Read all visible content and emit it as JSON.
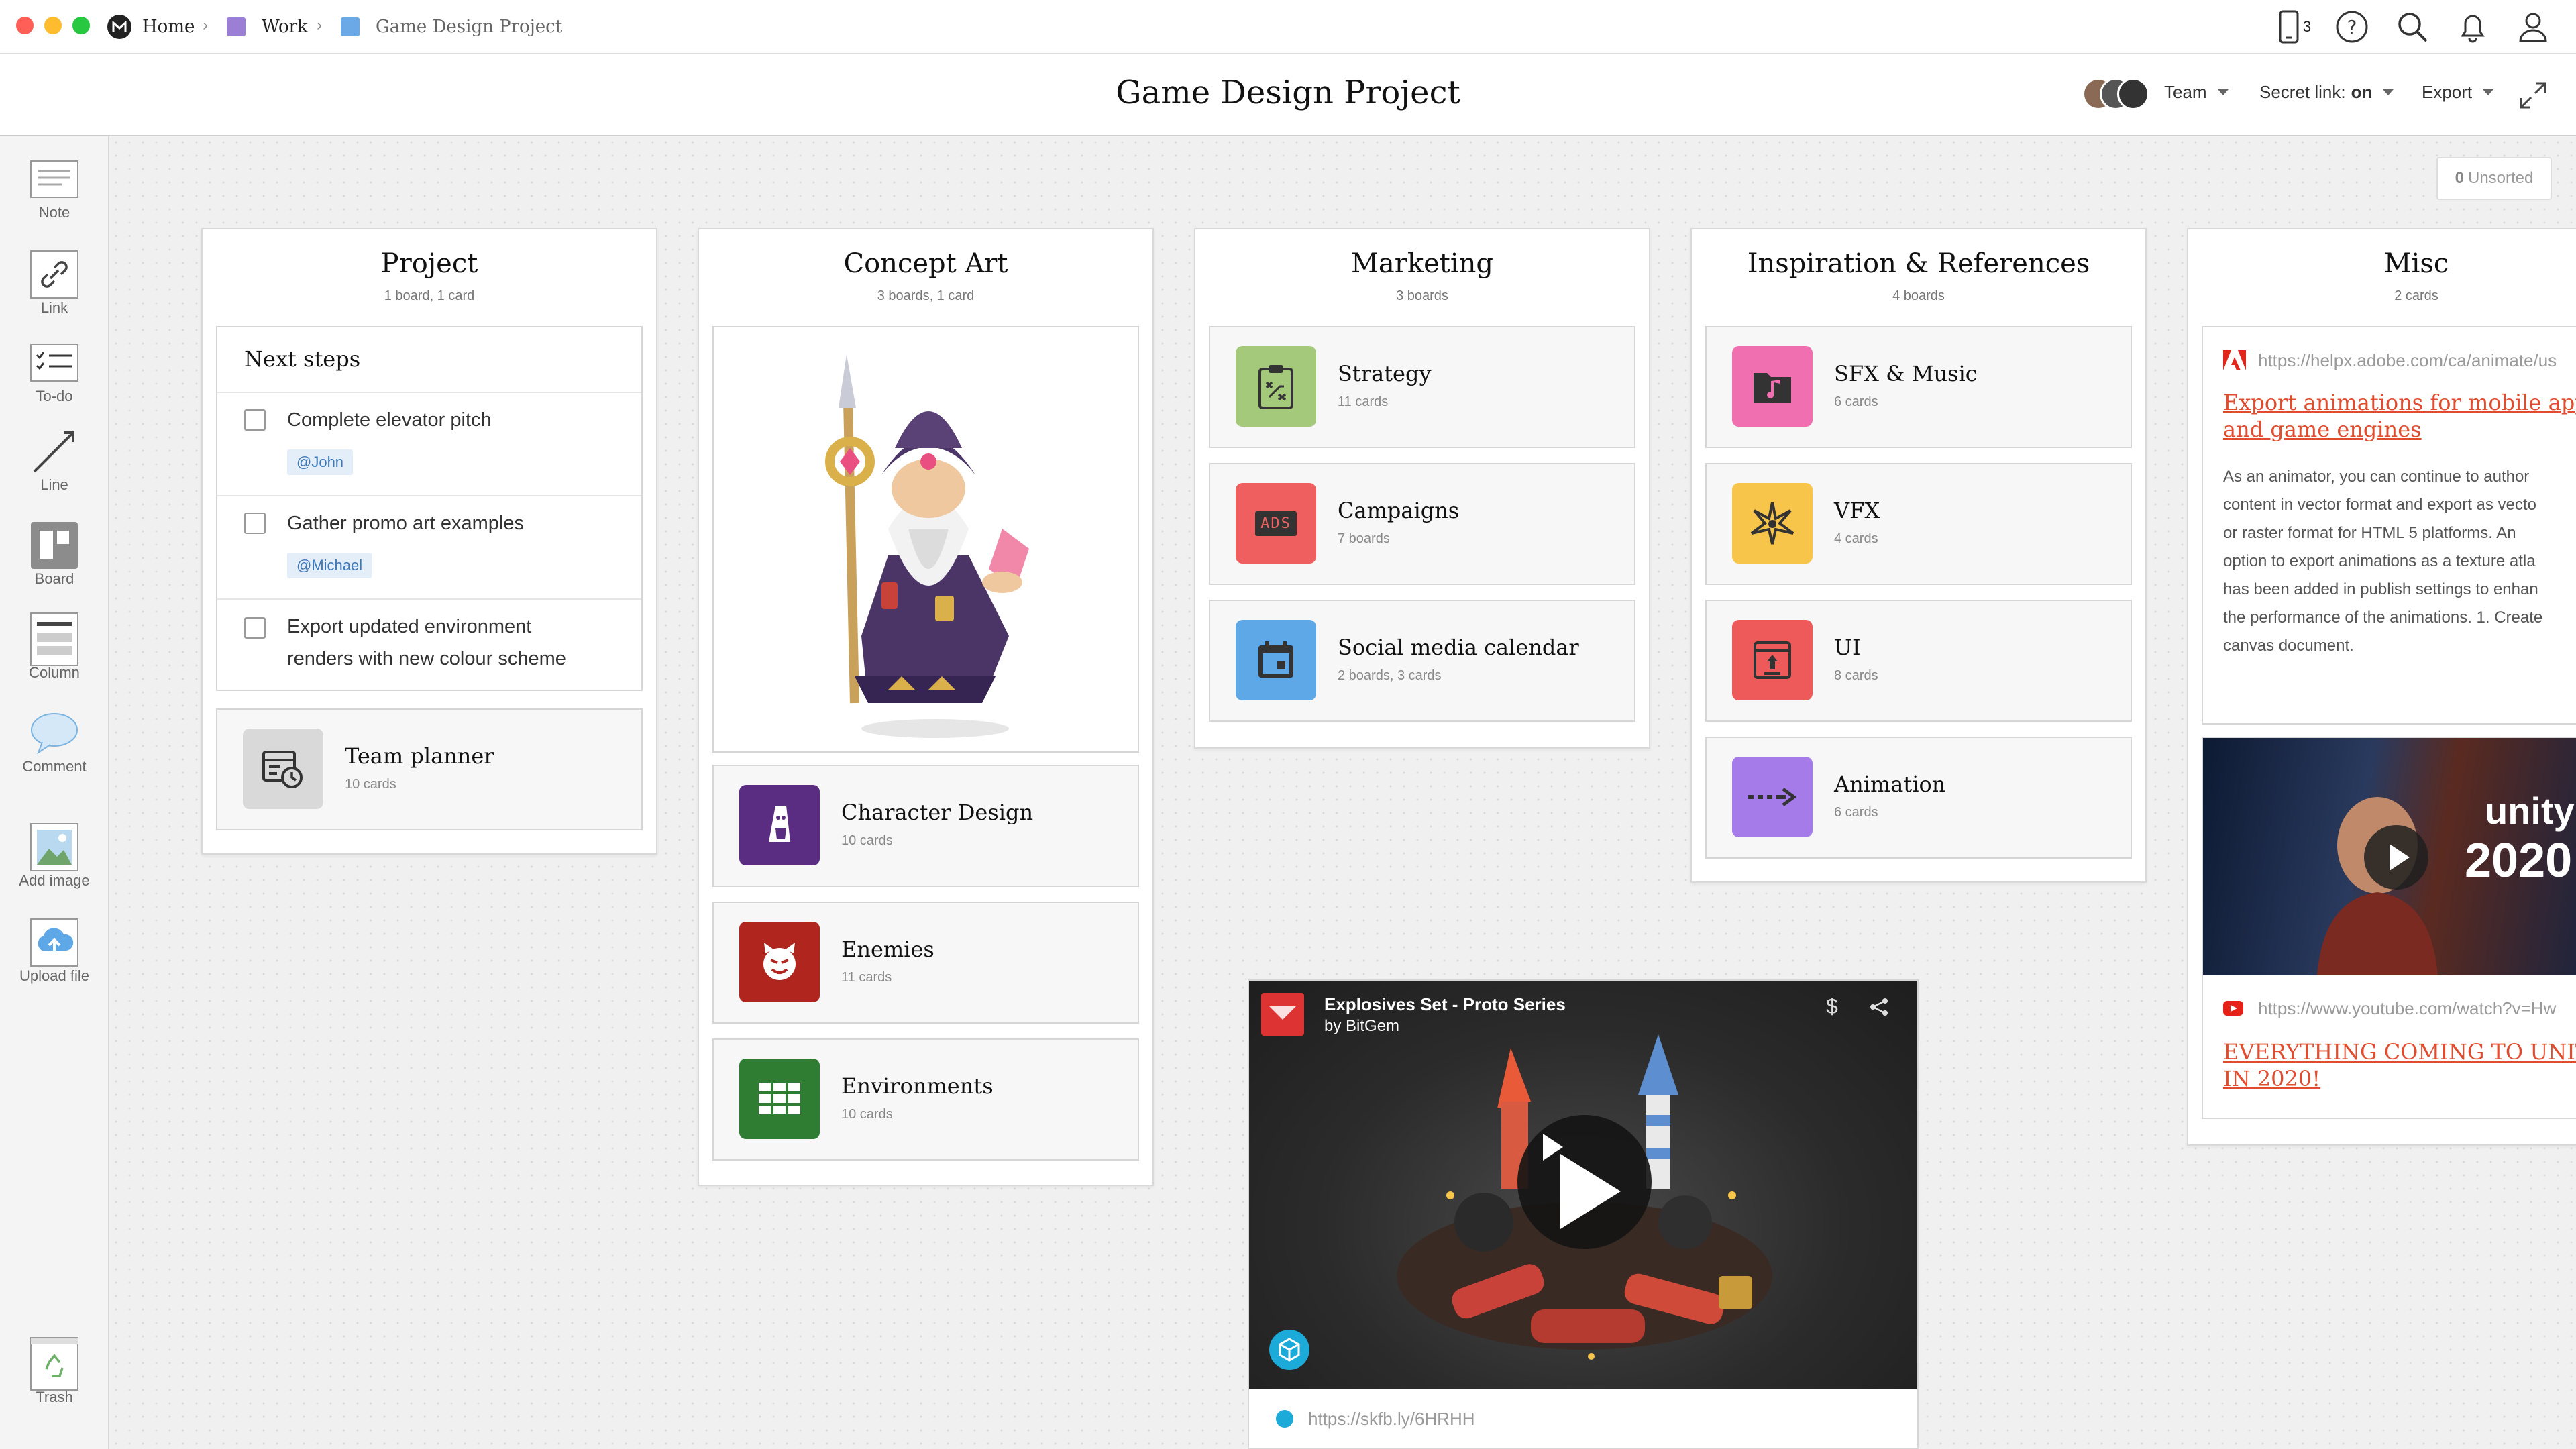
{
  "breadcrumb": {
    "home": "Home",
    "work": "Work",
    "project": "Game Design Project"
  },
  "topbar": {
    "device_count": "3"
  },
  "header": {
    "title": "Game Design Project",
    "team_label": "Team",
    "secret_link_label": "Secret link:",
    "secret_link_value": "on",
    "export_label": "Export"
  },
  "sidebar": {
    "tools": [
      {
        "label": "Note",
        "icon": "note-icon"
      },
      {
        "label": "Link",
        "icon": "link-icon"
      },
      {
        "label": "To-do",
        "icon": "todo-icon"
      },
      {
        "label": "Line",
        "icon": "line-icon"
      },
      {
        "label": "Board",
        "icon": "board-icon"
      },
      {
        "label": "Column",
        "icon": "column-icon"
      },
      {
        "label": "Comment",
        "icon": "comment-icon"
      },
      {
        "label": "Add image",
        "icon": "image-icon"
      },
      {
        "label": "Upload file",
        "icon": "upload-icon"
      }
    ],
    "trash_label": "Trash"
  },
  "unsorted": {
    "count": "0",
    "label": "Unsorted"
  },
  "columns": {
    "project": {
      "title": "Project",
      "subtitle": "1 board, 1 card",
      "todo_title": "Next steps",
      "todos": [
        {
          "text": "Complete elevator pitch",
          "tag": "@John"
        },
        {
          "text": "Gather promo art examples",
          "tag": "@Michael"
        },
        {
          "text_line1": "Export updated environment",
          "text_line2": "renders with new colour scheme"
        }
      ],
      "board": {
        "title": "Team planner",
        "subtitle": "10 cards",
        "icon": "planner-icon",
        "color": "#d9d9d9"
      }
    },
    "concept_art": {
      "title": "Concept Art",
      "subtitle": "3 boards, 1 card",
      "image": "wizard-character-image",
      "boards": [
        {
          "title": "Character Design",
          "subtitle": "10 cards",
          "icon": "character-icon",
          "color": "#5b2d82"
        },
        {
          "title": "Enemies",
          "subtitle": "11 cards",
          "icon": "devil-icon",
          "color": "#b0261f"
        },
        {
          "title": "Environments",
          "subtitle": "10 cards",
          "icon": "grid-icon",
          "color": "#2e7d32"
        }
      ]
    },
    "marketing": {
      "title": "Marketing",
      "subtitle": "3 boards",
      "boards": [
        {
          "title": "Strategy",
          "subtitle": "11 cards",
          "icon": "clipboard-icon",
          "color": "#a5c97a"
        },
        {
          "title": "Campaigns",
          "subtitle": "7 boards",
          "icon": "ads-icon",
          "icon_text": "ADS",
          "color": "#ef5f5f"
        },
        {
          "title": "Social media calendar",
          "subtitle": "2 boards, 3 cards",
          "icon": "calendar-icon",
          "color": "#5fa8e8"
        }
      ]
    },
    "inspiration": {
      "title": "Inspiration & References",
      "subtitle": "4 boards",
      "boards": [
        {
          "title": "SFX & Music",
          "subtitle": "6 cards",
          "icon": "music-icon",
          "color": "#ef6fb0"
        },
        {
          "title": "VFX",
          "subtitle": "4 cards",
          "icon": "sparkle-icon",
          "color": "#f7c54a"
        },
        {
          "title": "UI",
          "subtitle": "8 cards",
          "icon": "ui-icon",
          "color": "#ee5a5a"
        },
        {
          "title": "Animation",
          "subtitle": "6 cards",
          "icon": "arrow-icon",
          "color": "#a47be8"
        }
      ]
    },
    "misc": {
      "title": "Misc",
      "subtitle": "2 cards",
      "link1": {
        "url": "https://helpx.adobe.com/ca/animate/us",
        "title_line1": "Export animations for mobile app",
        "title_line2": "and game engines",
        "desc_lines": [
          "As an animator, you can continue to author",
          "content in vector format and export as vecto",
          "or raster format for HTML 5 platforms. An",
          "option to export animations as a texture atla",
          "has been added in publish settings to enhan",
          "the performance of the animations. 1. Create",
          "canvas document."
        ]
      },
      "link2": {
        "url": "https://www.youtube.com/watch?v=Hw",
        "title_line1": "EVERYTHING COMING TO UNITY",
        "title_line2": "IN 2020!",
        "thumb_text1": "unity",
        "thumb_text2": "2020"
      }
    }
  },
  "video_card": {
    "title": "Explosives Set - Proto Series",
    "author": "by BitGem",
    "url": "https://skfb.ly/6HRHH"
  }
}
